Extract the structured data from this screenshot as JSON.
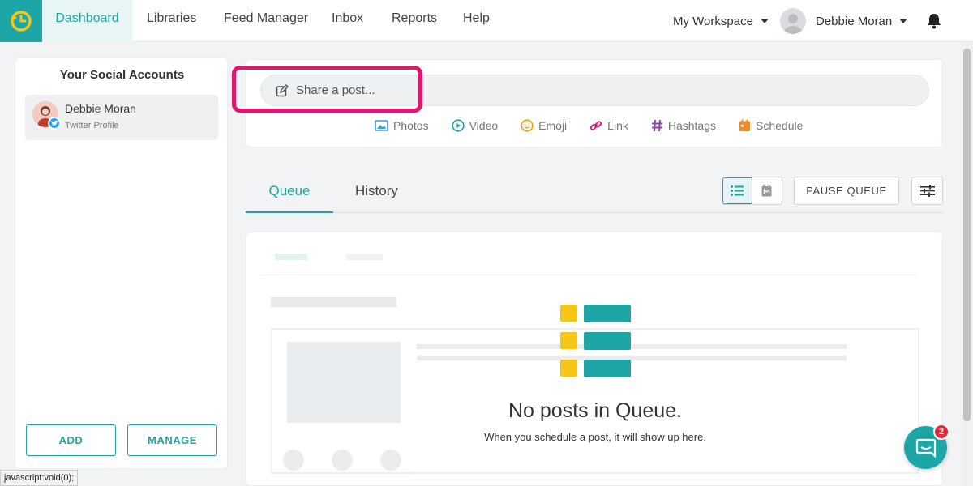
{
  "topnav": {
    "items": [
      {
        "label": "Dashboard",
        "active": true
      },
      {
        "label": "Libraries"
      },
      {
        "label": "Feed Manager"
      },
      {
        "label": "Inbox"
      },
      {
        "label": "Reports"
      },
      {
        "label": "Help"
      }
    ],
    "workspace": "My Workspace",
    "user_name": "Debbie Moran",
    "icons": [
      "clock-logo-icon",
      "user-avatar-icon",
      "bell-icon"
    ]
  },
  "sidebar": {
    "title": "Your Social Accounts",
    "accounts": [
      {
        "name": "Debbie Moran",
        "type": "Twitter Profile"
      }
    ],
    "add_label": "ADD",
    "manage_label": "MANAGE"
  },
  "composer": {
    "placeholder": "Share a post...",
    "media": [
      {
        "label": "Photos",
        "icon": "photo-icon",
        "color": "#3b9bd9"
      },
      {
        "label": "Video",
        "icon": "play-icon",
        "color": "#1ea5a5"
      },
      {
        "label": "Emoji",
        "icon": "emoji-icon",
        "color": "#f0a400"
      },
      {
        "label": "Link",
        "icon": "link-icon",
        "color": "#e0176d"
      },
      {
        "label": "Hashtags",
        "icon": "hashtag-icon",
        "color": "#8e44ad"
      },
      {
        "label": "Schedule",
        "icon": "calendar-icon",
        "color": "#f08a24"
      }
    ]
  },
  "tabs": {
    "queue": "Queue",
    "history": "History",
    "pause_label": "PAUSE QUEUE"
  },
  "empty_state": {
    "title": "No posts in Queue.",
    "subtitle": "When you schedule a post, it will show up here."
  },
  "chat": {
    "badge_count": "2"
  },
  "status_bar": "javascript:void(0);",
  "colors": {
    "accent": "#1ea5a5",
    "highlight": "#e0176d",
    "badge": "#e22a3a",
    "icon_yellow": "#f5c518"
  }
}
